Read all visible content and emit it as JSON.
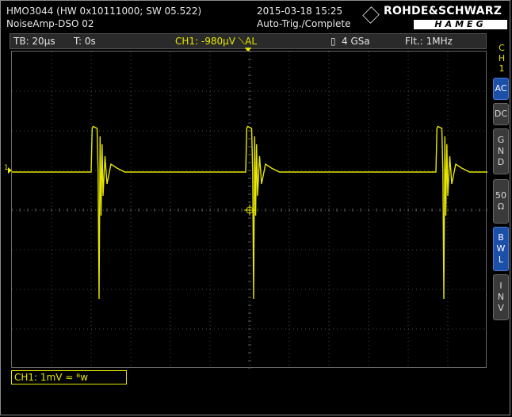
{
  "header": {
    "model": "HMO3044 (HW 0x10111000; SW 05.522)",
    "filename": "NoiseAmp-DSO 02",
    "datetime": "2015-03-18 15:25",
    "status": "Auto-Trig./Complete",
    "logo_top": "ROHDE&SCHWARZ",
    "logo_bottom": "HAMEG"
  },
  "status_bar": {
    "timebase": "TB: 20µs",
    "trigger_time": "T: 0s",
    "ch1_trigger": "CH1: -980µV ⟍AL",
    "sample_rate": "4 GSa",
    "filter": "Flt.: 1MHz"
  },
  "side_panel": {
    "channel_label": "CH1",
    "buttons": [
      {
        "label": "AC",
        "active": true
      },
      {
        "label": "DC",
        "active": false
      },
      {
        "label": "GND",
        "active": false
      },
      {
        "label": "50Ω",
        "active": false
      },
      {
        "label": "BWL",
        "active": true
      },
      {
        "label": "INV",
        "active": false
      }
    ]
  },
  "channel_info": {
    "ch1_scale": "CH1: 1mV ≈ ᴮw",
    "marker": "1"
  },
  "colors": {
    "trace": "#e6e600",
    "grid": "#4a4a4a",
    "accent_active": "#1c4fa8"
  },
  "chart_data": {
    "type": "line",
    "title": "",
    "xlabel": "",
    "ylabel": "",
    "grid": true,
    "divisions_x": 12,
    "divisions_y": 8,
    "xlim": [
      -120,
      120
    ],
    "ylim": [
      -4,
      4
    ],
    "series": [
      {
        "x": [
          -120,
          -80,
          -79.5,
          -79,
          -77,
          -76.5,
          -76,
          -75.5,
          -75,
          -74.5,
          -74,
          -73,
          -72,
          -70,
          -67,
          -63,
          -55,
          -40,
          -20,
          -2,
          -1.5,
          -1,
          1,
          1.5,
          2,
          2.5,
          3,
          3.5,
          4,
          5,
          6,
          8,
          11,
          15,
          22,
          40,
          70,
          94,
          94.5,
          95,
          97,
          97.5,
          98,
          98.5,
          99,
          99.5,
          100,
          101,
          102,
          104,
          107,
          111,
          120
        ],
        "values": [
          0,
          0,
          1.1,
          1.15,
          1.1,
          0,
          -3.2,
          0.9,
          -1.1,
          0.7,
          -0.6,
          0.4,
          -0.3,
          0.2,
          0.1,
          0,
          0,
          0,
          0,
          0,
          1.1,
          1.15,
          1.1,
          0,
          -3.2,
          0.9,
          -1.1,
          0.7,
          -0.6,
          0.4,
          -0.3,
          0.2,
          0.1,
          0,
          0,
          0,
          0,
          0,
          1.1,
          1.15,
          1.1,
          0,
          -3.2,
          0.9,
          -1.1,
          0.7,
          -0.6,
          0.4,
          -0.3,
          0.2,
          0.1,
          0,
          0
        ]
      }
    ]
  }
}
